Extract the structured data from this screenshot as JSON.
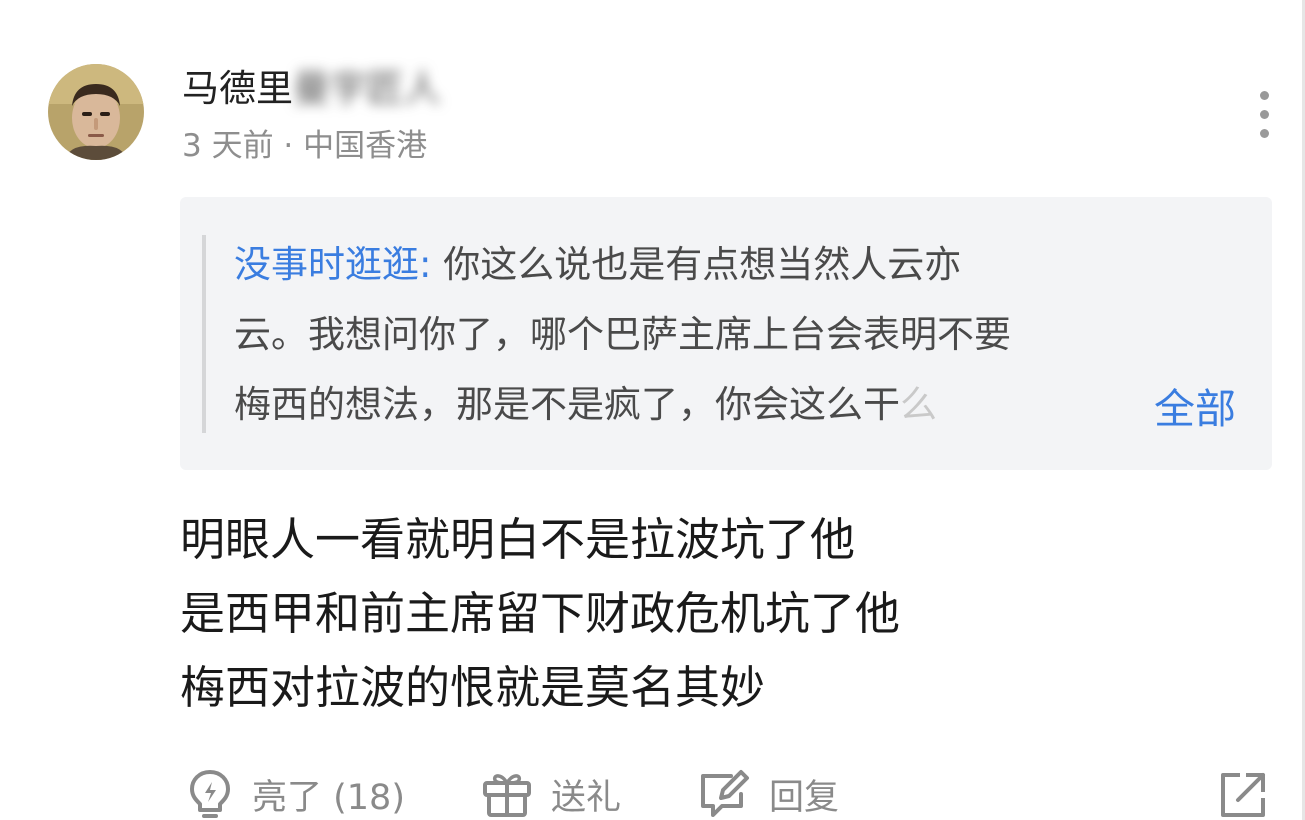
{
  "comment": {
    "author": {
      "name_visible": "马德里",
      "name_blurred": "曼宇匠人",
      "avatar_icon": "user-avatar-photo"
    },
    "meta": "3 天前 · 中国香港",
    "quote": {
      "author": "没事时逛逛:",
      "line1_rest": " 你这么说也是有点想当然人云亦",
      "line2": "云。我想问你了，哪个巴萨主席上台会表明不要",
      "line3": "梅西的想法，那是不是疯了，你会这么干",
      "line3_faded": "么",
      "expand_label": "全部"
    },
    "body": [
      "明眼人一看就明白不是拉波坑了他",
      "是西甲和前主席留下财政危机坑了他",
      "梅西对拉波的恨就是莫名其妙"
    ]
  },
  "actions": {
    "like_label": "亮了 (18)",
    "gift_label": "送礼",
    "reply_label": "回复"
  },
  "icons": {
    "more": "more-vertical-icon",
    "like": "lightbulb-icon",
    "gift": "gift-icon",
    "reply": "reply-edit-icon",
    "share": "share-external-icon"
  },
  "colors": {
    "link_blue": "#3a7de0",
    "quote_bg": "#f3f4f6",
    "meta_gray": "#8e8e8e",
    "text_dark": "#1a1a1a"
  }
}
